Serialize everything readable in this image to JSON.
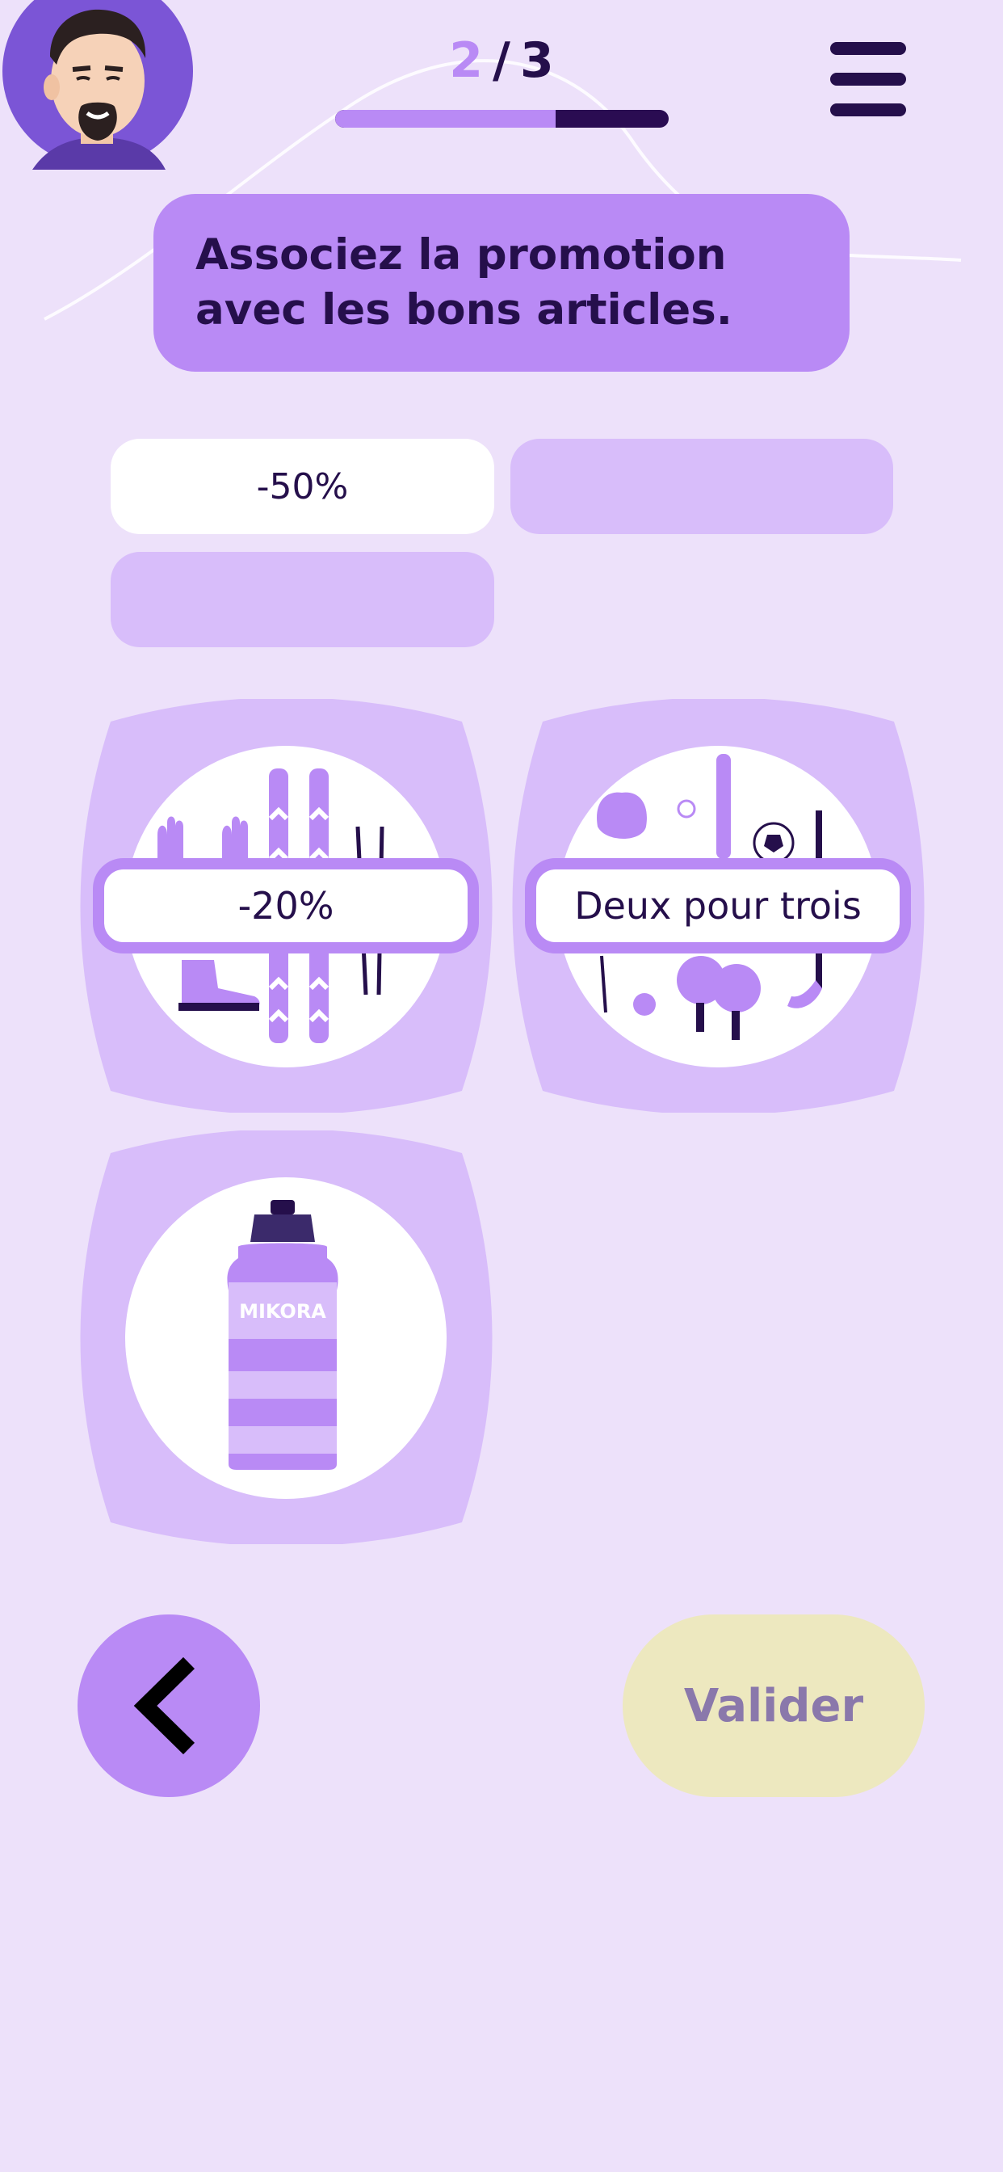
{
  "progress": {
    "current": "2",
    "separator": "/",
    "total": "3",
    "fraction_done": 0.66
  },
  "instruction": "Associez la promotion avec les bons articles.",
  "answer_slots": [
    {
      "label": "-50%"
    },
    {
      "label": ""
    },
    {
      "label": ""
    }
  ],
  "cards": [
    {
      "illustration": "ski-equipment",
      "promotion": "-20%"
    },
    {
      "illustration": "sports-balls-equipment",
      "promotion": "Deux pour trois"
    },
    {
      "illustration": "water-bottle",
      "bottle_brand": "MIKORA",
      "promotion": ""
    }
  ],
  "buttons": {
    "back_icon": "chevron-left-icon",
    "validate_label": "Valider"
  },
  "colors": {
    "background": "#ede1fa",
    "accent": "#b98af5",
    "accent_light": "#d8bdfa",
    "dark": "#250f4b",
    "validate_bg": "#ede8bf",
    "validate_text": "#8a78ab"
  }
}
